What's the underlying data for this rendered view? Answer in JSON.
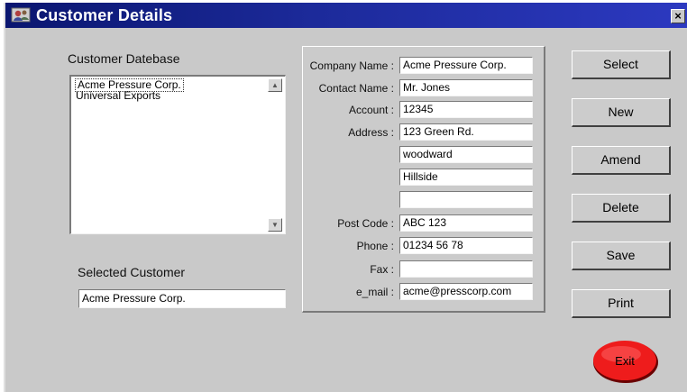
{
  "window": {
    "title": "Customer Details",
    "close_label": "×"
  },
  "customer_database": {
    "label": "Customer Datebase",
    "items": [
      {
        "label": "Acme Pressure Corp.",
        "selected": true
      },
      {
        "label": "Universal Exports",
        "selected": false
      }
    ]
  },
  "selected_customer": {
    "label": "Selected Customer",
    "value": "Acme Pressure Corp."
  },
  "details": {
    "company_name": {
      "label": "Company Name :",
      "value": "Acme Pressure Corp."
    },
    "contact_name": {
      "label": "Contact Name :",
      "value": "Mr. Jones"
    },
    "account": {
      "label": "Account :",
      "value": "12345"
    },
    "address": {
      "label": "Address :",
      "lines": [
        "123 Green Rd.",
        "woodward",
        "Hillside",
        ""
      ]
    },
    "post_code": {
      "label": "Post Code :",
      "value": "ABC 123"
    },
    "phone": {
      "label": "Phone :",
      "value": "01234 56 78"
    },
    "fax": {
      "label": "Fax :",
      "value": ""
    },
    "email": {
      "label": "e_mail :",
      "value": "acme@presscorp.com"
    }
  },
  "buttons": {
    "select": "Select",
    "new": "New",
    "amend": "Amend",
    "delete": "Delete",
    "save": "Save",
    "print": "Print",
    "exit": "Exit"
  },
  "colors": {
    "titlebar": "#0a1670",
    "exit_button": "#ee1c1c",
    "window_bg": "#c9c9c9"
  }
}
